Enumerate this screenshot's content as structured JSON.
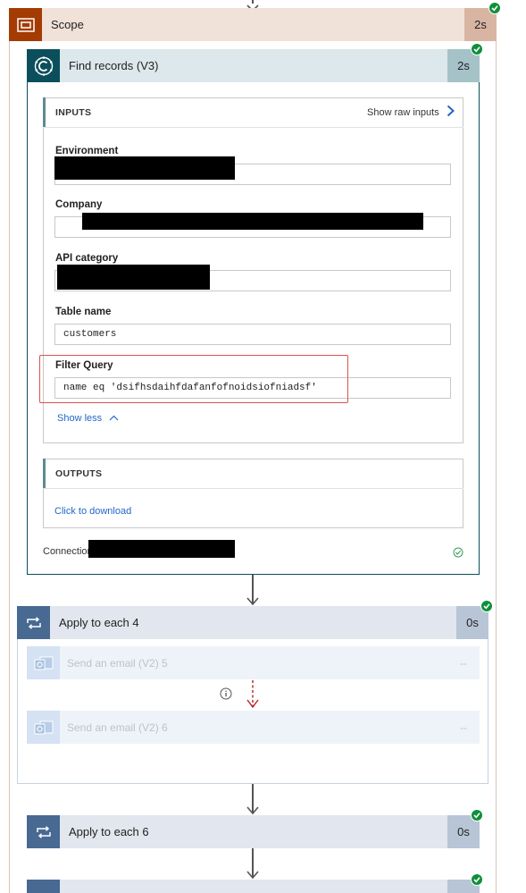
{
  "scope": {
    "title": "Scope",
    "duration": "2s"
  },
  "find_records": {
    "title": "Find records (V3)",
    "duration": "2s",
    "inputs": {
      "heading": "INPUTS",
      "show_raw": "Show raw inputs",
      "fields": [
        {
          "label": "Environment",
          "value": ""
        },
        {
          "label": "Company",
          "value": ""
        },
        {
          "label": "API category",
          "value": ""
        },
        {
          "label": "Table name",
          "value": "customers"
        },
        {
          "label": "Filter Query",
          "value": "name eq 'dsifhsdaihfdafanfofnoidsiofniadsf'"
        }
      ],
      "show_less": "Show less"
    },
    "outputs": {
      "heading": "OUTPUTS",
      "download": "Click to download"
    },
    "connection_label": "Connection"
  },
  "apply_each_4": {
    "title": "Apply to each 4",
    "duration": "0s",
    "children": [
      {
        "title": "Send an email (V2) 5",
        "duration": "--"
      },
      {
        "title": "Send an email (V2) 6",
        "duration": "--"
      }
    ]
  },
  "apply_each_6": {
    "title": "Apply to each 6",
    "duration": "0s"
  },
  "colors": {
    "scope_icon_bg": "#a33b03",
    "scope_header_bg": "#f0e1d9",
    "scope_time_bg": "#d8b5a2",
    "dataverse_icon_bg": "#0b4f5c",
    "dataverse_header_bg": "#dce8eb",
    "dataverse_time_bg": "#a5c2c8",
    "loop_icon_bg": "#486991",
    "loop_header_bg": "#e2e6ee",
    "loop_time_bg": "#b7c5d6",
    "success_green": "#0f8f3a",
    "highlight_red": "#d9534f",
    "link_blue": "#2266c9"
  }
}
